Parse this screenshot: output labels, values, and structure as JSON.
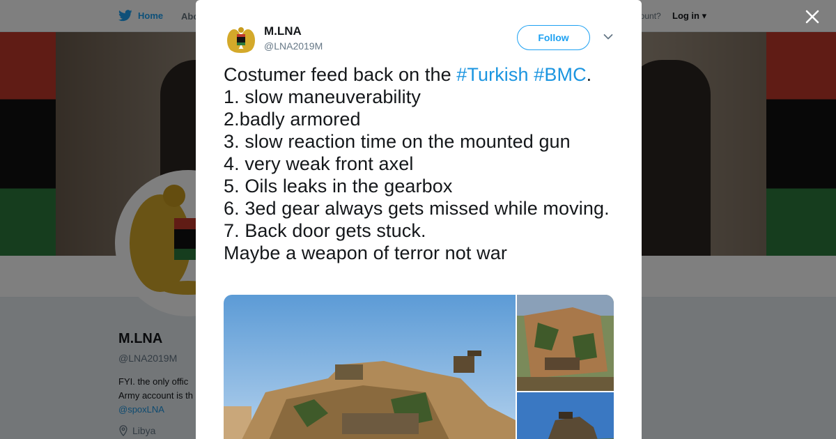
{
  "nav": {
    "home_label": "Home",
    "about_label": "Abo",
    "account_text": "account?",
    "login_label": "Log in"
  },
  "profile": {
    "name": "M.LNA",
    "handle": "@LNA2019M",
    "bio_line1": "FYI. the only offic",
    "bio_line2": "Army account is th",
    "bio_link": "@spoxLNA",
    "location": "Libya"
  },
  "tweet": {
    "author_name": "M.LNA",
    "author_handle": "@LNA2019M",
    "follow_label": "Follow",
    "text_prefix": "Costumer feed back on the ",
    "hashtag1": "#Turkish",
    "space": " ",
    "hashtag2": "#BMC",
    "text_after_tags": ".",
    "body": "1. slow maneuverability\n2.badly armored\n3. slow reaction time on the mounted gun\n4. very weak front axel\n5. Oils leaks in the gearbox\n6. 3ed gear always gets missed while moving.\n7. Back door gets stuck.\nMaybe a weapon of terror not war"
  },
  "icons": {
    "bird": "twitter-bird-icon",
    "close": "close-icon",
    "caret": "chevron-down-icon",
    "location": "location-pin-icon"
  },
  "colors": {
    "accent": "#1da1f2",
    "link": "#1b95e0",
    "text": "#14171a",
    "muted": "#657786"
  }
}
